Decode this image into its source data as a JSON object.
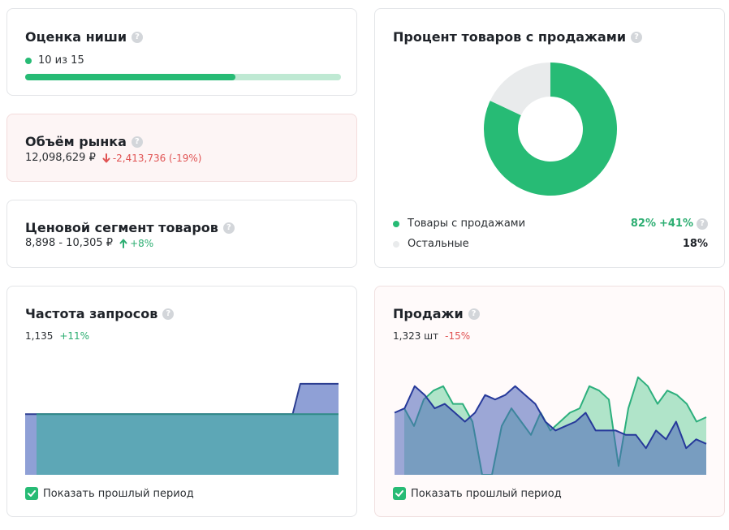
{
  "niche": {
    "title": "Оценка ниши",
    "score_text": "10 из 15",
    "score_fraction": 0.667,
    "accent": "#27bb75"
  },
  "market": {
    "title": "Объём рынка",
    "value": "12,098,629 ₽",
    "delta": "-2,413,736 (-19%)"
  },
  "price": {
    "title": "Ценовой сегмент товаров",
    "value": "8,898 - 10,305 ₽",
    "delta": "+8%"
  },
  "percent": {
    "title": "Процент товаров с продажами",
    "legend": [
      {
        "label": "Товары с продажами",
        "value": "82%",
        "delta": "+41%",
        "color": "#27bb75"
      },
      {
        "label": "Остальные",
        "value": "18%",
        "color": "#e9ebec"
      }
    ]
  },
  "requests": {
    "title": "Частота запросов",
    "value": "1,135",
    "delta": "+11%",
    "checkbox_label": "Показать прошлый период"
  },
  "sales": {
    "title": "Продажи",
    "value": "1,323 шт",
    "delta": "-15%",
    "checkbox_label": "Показать прошлый период"
  },
  "chart_data": [
    {
      "type": "pie",
      "labels": [
        "Товары с продажами",
        "Остальные"
      ],
      "values": [
        82,
        18
      ],
      "colors": [
        "#27bb75",
        "#e9ebec"
      ]
    },
    {
      "type": "area",
      "series": [
        {
          "values": [
            1,
            1,
            1,
            1,
            1,
            1,
            1,
            1,
            1,
            1,
            1,
            1,
            1,
            1,
            1,
            1,
            1,
            1,
            1,
            1,
            1,
            1,
            1,
            1,
            1,
            1,
            1,
            1,
            1,
            1,
            1,
            1,
            1,
            1,
            1,
            1,
            1.5,
            1.5,
            1.5,
            1.5,
            1.5,
            1.5
          ]
        },
        {
          "values": [
            1,
            1,
            1,
            1,
            1,
            1,
            1,
            1,
            1,
            1,
            1,
            1,
            1,
            1,
            1,
            1,
            1,
            1,
            1,
            1,
            1,
            1,
            1,
            1,
            1,
            1,
            1,
            1,
            1,
            1,
            1,
            1,
            1,
            1,
            1,
            1,
            1,
            1,
            1,
            1,
            1,
            1
          ]
        }
      ]
    },
    {
      "type": "area",
      "series": [
        {
          "values": [
            0.75,
            0.55,
            0.85,
            0.95,
            1.0,
            0.8,
            0.8,
            0.6,
            0.0,
            0.0,
            0.55,
            0.75,
            0.6,
            0.45,
            0.7,
            0.5,
            0.6,
            0.7,
            0.75,
            1.0,
            0.95,
            0.85,
            0.1,
            0.75,
            1.1,
            1.0,
            0.8,
            0.95,
            0.9,
            0.8,
            0.6,
            0.65
          ]
        },
        {
          "values": [
            0.7,
            0.75,
            1.0,
            0.9,
            0.75,
            0.8,
            0.7,
            0.6,
            0.7,
            0.9,
            0.85,
            0.9,
            1.0,
            0.9,
            0.8,
            0.6,
            0.5,
            0.55,
            0.6,
            0.7,
            0.5,
            0.5,
            0.5,
            0.45,
            0.45,
            0.3,
            0.5,
            0.4,
            0.6,
            0.3,
            0.4,
            0.35
          ]
        }
      ]
    }
  ]
}
